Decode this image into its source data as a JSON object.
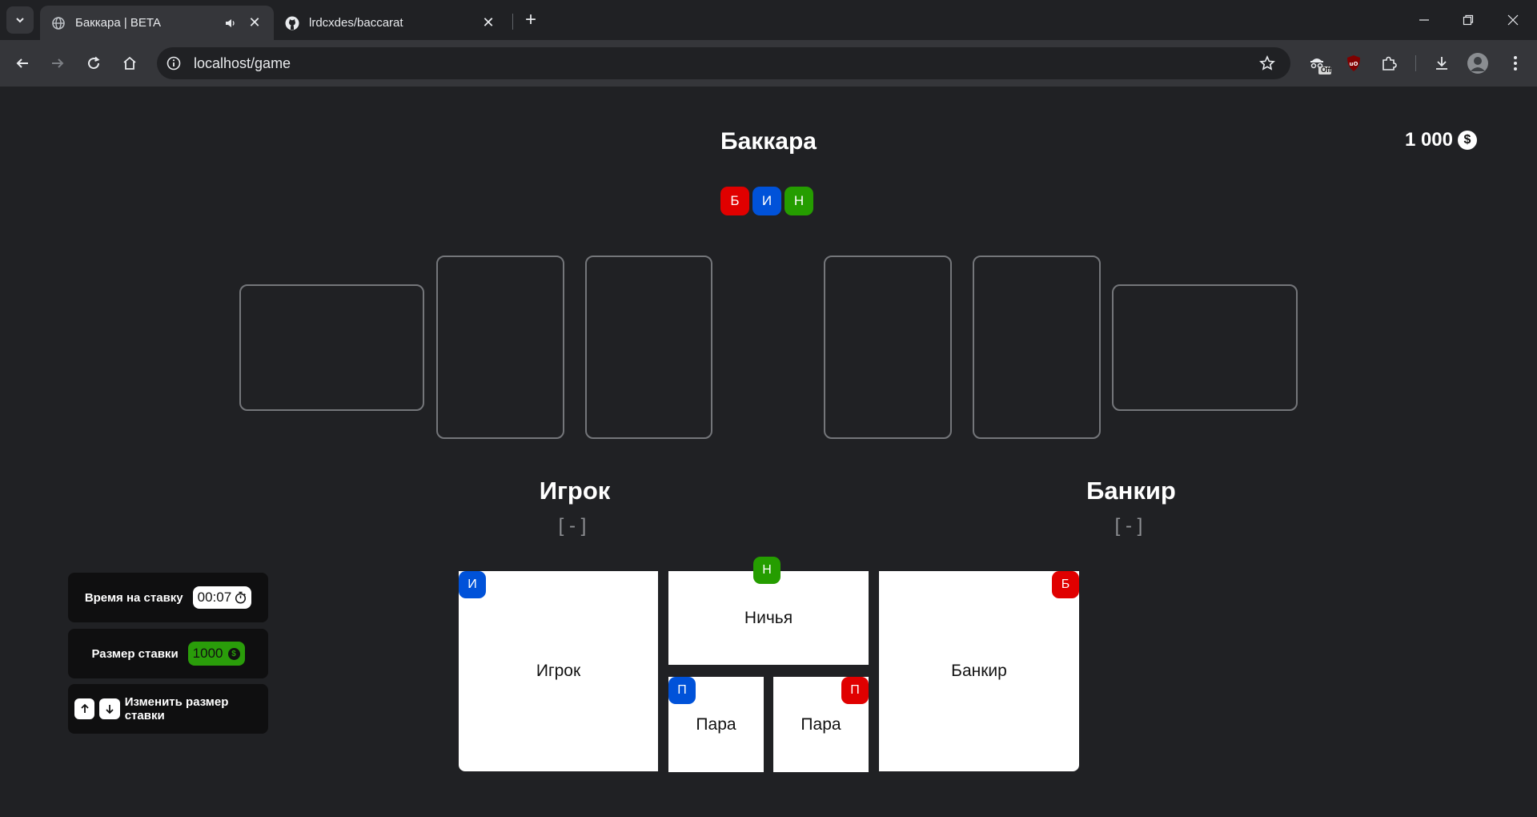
{
  "browser": {
    "tabs": [
      {
        "title": "Баккара | BETA"
      },
      {
        "title": "lrdcxdes/baccarat"
      }
    ],
    "url": "localhost/game",
    "extension_badge": "Off"
  },
  "game": {
    "title": "Баккара",
    "balance": "1 000",
    "currency_symbol": "$",
    "history": [
      {
        "label": "Б",
        "color": "#e00000"
      },
      {
        "label": "И",
        "color": "#0052d9"
      },
      {
        "label": "Н",
        "color": "#259d00"
      }
    ],
    "player": {
      "label": "Игрок",
      "score": "[ - ]"
    },
    "banker": {
      "label": "Банкир",
      "score": "[ - ]"
    }
  },
  "controls": {
    "time_label": "Время на ставку",
    "time_value": "00:07",
    "bet_size_label": "Размер ставки",
    "bet_size_value": "1000",
    "change_bet_label": "Изменить размер ставки"
  },
  "bets": {
    "player": {
      "label": "Игрок",
      "badge": "И",
      "color": "#0052d9"
    },
    "tie": {
      "label": "Ничья",
      "badge": "Н",
      "color": "#259d00"
    },
    "player_pair": {
      "label": "Пара",
      "badge": "П",
      "color": "#0052d9"
    },
    "banker_pair": {
      "label": "Пара",
      "badge": "П",
      "color": "#e00000"
    },
    "banker": {
      "label": "Банкир",
      "badge": "Б",
      "color": "#e00000"
    }
  }
}
